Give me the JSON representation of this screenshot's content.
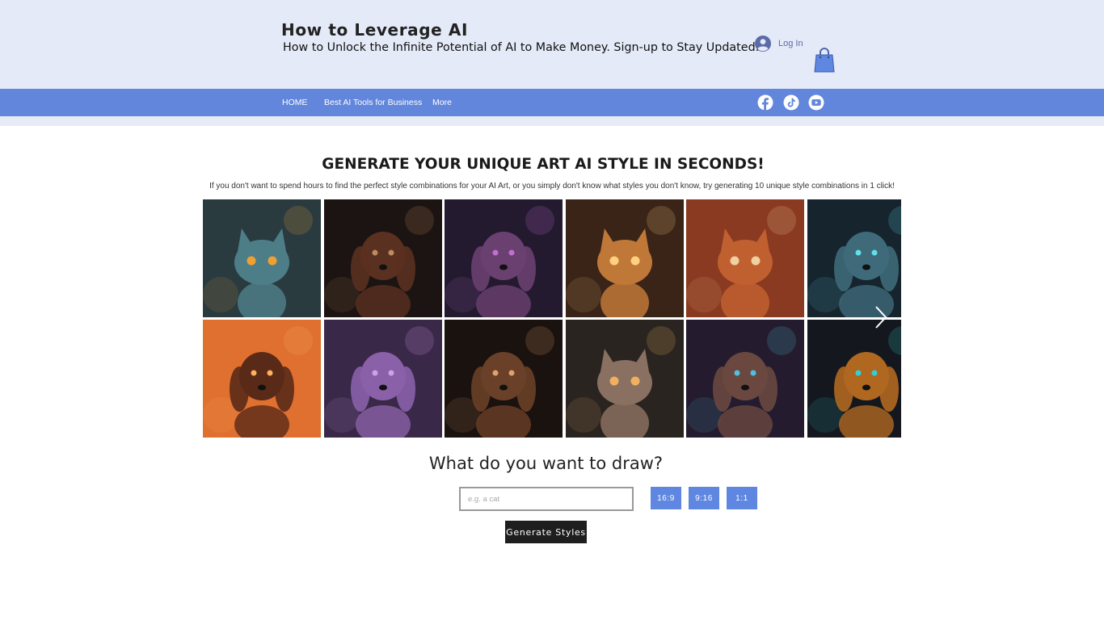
{
  "header": {
    "site_title": "How to Leverage AI",
    "tagline": "How to Unlock the Infinite Potential of AI to Make Money. Sign-up to Stay Updated.",
    "login_label": "Log In",
    "icons": {
      "avatar": "user-avatar-icon",
      "cart": "shopping-bag-icon"
    }
  },
  "nav": {
    "items": [
      {
        "label": "HOME"
      },
      {
        "label": "Best AI Tools for Business"
      },
      {
        "label": "More"
      }
    ],
    "social": [
      "facebook-icon",
      "tiktok-icon",
      "youtube-icon"
    ]
  },
  "hero": {
    "title": "GENERATE YOUR UNIQUE ART AI STYLE IN SECONDS!",
    "subtitle": "If you don't want to spend hours to find the perfect style combinations for your AI Art, or you simply don't know what styles you don't know, try generating 10 unique style combinations in 1 click!"
  },
  "gallery": {
    "tiles": [
      {
        "subject": "cat",
        "bg": "#2a3b40",
        "fg": "#4d7e88",
        "accent": "#f0a030"
      },
      {
        "subject": "dog",
        "bg": "#1c1412",
        "fg": "#5a3020",
        "accent": "#c08a60"
      },
      {
        "subject": "dog",
        "bg": "#241a30",
        "fg": "#6a4070",
        "accent": "#c070d0"
      },
      {
        "subject": "cat",
        "bg": "#3a2418",
        "fg": "#c07838",
        "accent": "#ffd080"
      },
      {
        "subject": "cat",
        "bg": "#8a3a20",
        "fg": "#c06030",
        "accent": "#f0d0a0"
      },
      {
        "subject": "dog",
        "bg": "#16242e",
        "fg": "#3e6a7a",
        "accent": "#60e0e8"
      },
      {
        "subject": "dog",
        "bg": "#e07030",
        "fg": "#5a2a18",
        "accent": "#ffb060"
      },
      {
        "subject": "dog",
        "bg": "#3a2848",
        "fg": "#8a60a8",
        "accent": "#d0a0e8"
      },
      {
        "subject": "dog",
        "bg": "#1a120e",
        "fg": "#6a4028",
        "accent": "#e0a070"
      },
      {
        "subject": "cat",
        "bg": "#2a2420",
        "fg": "#8a7060",
        "accent": "#f0b060"
      },
      {
        "subject": "dog",
        "bg": "#241c2e",
        "fg": "#6a4840",
        "accent": "#50c0e0"
      },
      {
        "subject": "dog",
        "bg": "#14181e",
        "fg": "#b06820",
        "accent": "#30d0d8"
      }
    ],
    "next_icon": "chevron-right-icon"
  },
  "form": {
    "question": "What do you want to draw?",
    "placeholder": "e.g. a cat",
    "value": "",
    "ratios": [
      "16:9",
      "9:16",
      "1:1"
    ],
    "generate_label": "Generate Styles"
  },
  "colors": {
    "header_bg": "#e4eaf8",
    "nav_bg": "#6286dc",
    "button_blue": "#5f86e0",
    "button_dark": "#1e1e1e"
  }
}
